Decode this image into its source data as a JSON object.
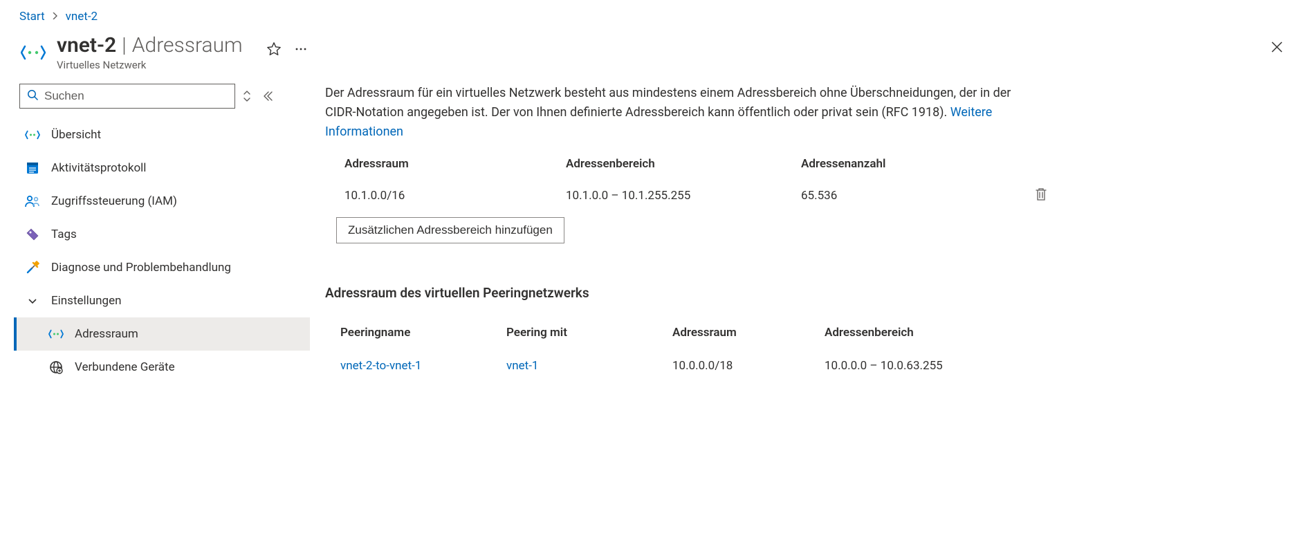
{
  "breadcrumb": {
    "start": "Start",
    "resource": "vnet-2"
  },
  "header": {
    "resource_name": "vnet-2",
    "blade_name": "Adressraum",
    "subtitle": "Virtuelles Netzwerk"
  },
  "sidebar": {
    "search_placeholder": "Suchen",
    "items": {
      "overview": "Übersicht",
      "activity_log": "Aktivitätsprotokoll",
      "iam": "Zugriffssteuerung (IAM)",
      "tags": "Tags",
      "diagnose": "Diagnose und Problembehandlung",
      "settings_group": "Einstellungen",
      "address_space": "Adressraum",
      "connected_devices": "Verbundene Geräte"
    }
  },
  "main": {
    "description_text": "Der Adressraum für ein virtuelles Netzwerk besteht aus mindestens einem Adressbereich ohne Überschneidungen, der in der CIDR-Notation angegeben ist. Der von Ihnen definierte Adressbereich kann öffentlich oder privat sein (RFC 1918). ",
    "learn_more": "Weitere Informationen",
    "address_table": {
      "headers": {
        "space": "Adressraum",
        "range": "Adressenbereich",
        "count": "Adressenanzahl"
      },
      "row": {
        "space": "10.1.0.0/16",
        "range": "10.1.0.0 – 10.1.255.255",
        "count": "65.536"
      },
      "add_button": "Zusätzlichen Adressbereich hinzufügen"
    },
    "peering": {
      "title": "Adressraum des virtuellen Peeringnetzwerks",
      "headers": {
        "name": "Peeringname",
        "with": "Peering mit",
        "space": "Adressraum",
        "range": "Adressenbereich"
      },
      "row": {
        "name": "vnet-2-to-vnet-1",
        "with": "vnet-1",
        "space": "10.0.0.0/18",
        "range": "10.0.0.0 – 10.0.63.255"
      }
    }
  }
}
